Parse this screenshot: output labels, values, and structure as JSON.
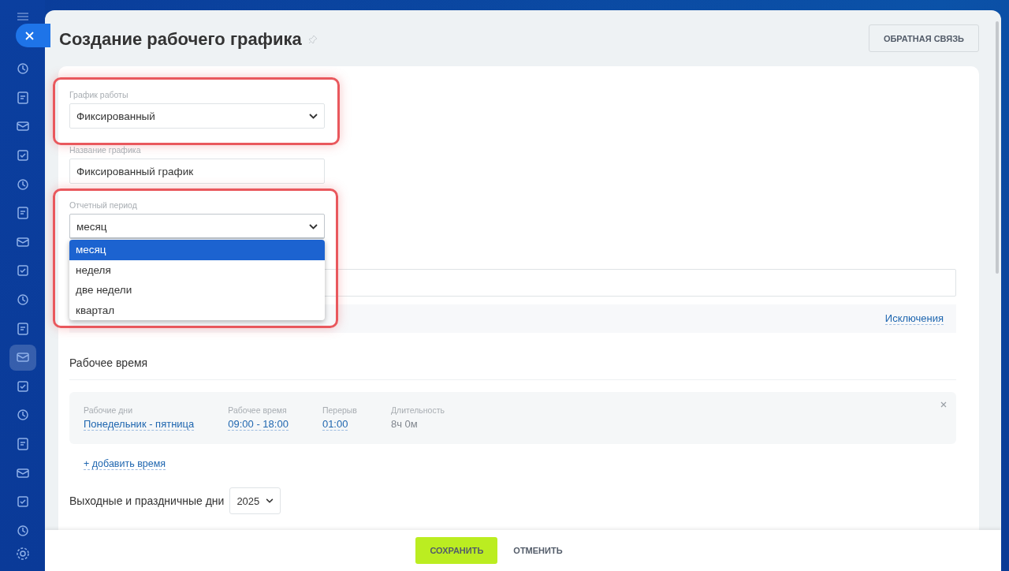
{
  "sidebar": {
    "items": [
      {
        "selected": false
      },
      {
        "selected": false
      },
      {
        "selected": false
      },
      {
        "selected": false
      },
      {
        "selected": false
      },
      {
        "selected": false
      },
      {
        "selected": false
      },
      {
        "selected": false
      },
      {
        "selected": false
      },
      {
        "selected": false
      },
      {
        "selected": true
      },
      {
        "selected": false
      },
      {
        "selected": false
      },
      {
        "selected": false
      },
      {
        "selected": false
      },
      {
        "selected": false
      },
      {
        "selected": false
      }
    ]
  },
  "header": {
    "title": "Создание рабочего графика",
    "feedback_button": "ОБРАТНАЯ СВЯЗЬ"
  },
  "form": {
    "schedule_type": {
      "label": "График работы",
      "value": "Фиксированный"
    },
    "schedule_name": {
      "label": "Название графика",
      "value": "Фиксированный график"
    },
    "report_period": {
      "label": "Отчетный период",
      "value": "месяц",
      "expanded": true,
      "options": [
        {
          "label": "месяц",
          "selected": true
        },
        {
          "label": "неделя",
          "selected": false
        },
        {
          "label": "две недели",
          "selected": false
        },
        {
          "label": "квартал",
          "selected": false
        }
      ]
    },
    "exceptions_link": "Исключения"
  },
  "working_time": {
    "title": "Рабочее время",
    "shifts": [
      {
        "columns": [
          {
            "label": "Рабочие дни",
            "value": "Понедельник - пятница",
            "kind": "link"
          },
          {
            "label": "Рабочее время",
            "value": "09:00 - 18:00",
            "kind": "link"
          },
          {
            "label": "Перерыв",
            "value": "01:00",
            "kind": "link"
          },
          {
            "label": "Длительность",
            "value": "8ч 0м",
            "kind": "text"
          }
        ]
      }
    ],
    "add_link": "+ добавить время"
  },
  "holidays": {
    "title": "Выходные и праздничные дни",
    "year": "2025"
  },
  "footer": {
    "save_button": "СОХРАНИТЬ",
    "cancel_button": "ОТМЕНИТЬ"
  }
}
